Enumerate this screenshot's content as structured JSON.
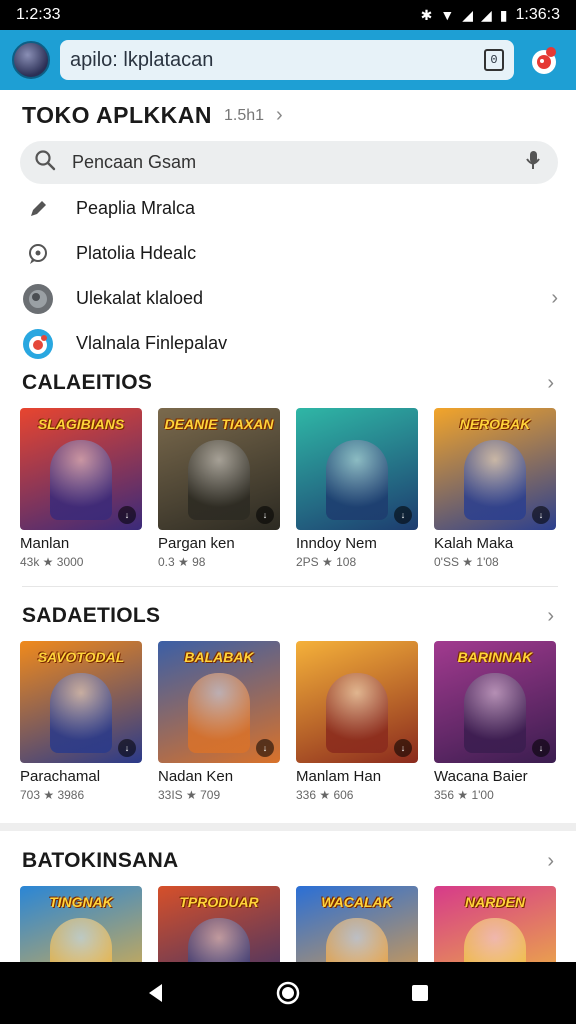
{
  "status_bar": {
    "time_left": "1:2:33",
    "time_right": "1:36:3"
  },
  "app_bar": {
    "search_text": "apilo: lkplatacan",
    "tab_count": "0"
  },
  "store": {
    "title": "TOKO APLKKAN",
    "subtitle": "1.5h1"
  },
  "search": {
    "placeholder": "Pencaan Gsam"
  },
  "menu": [
    {
      "label": "Peaplia Mralca",
      "icon": "pen-icon"
    },
    {
      "label": "Platolia Hdealc",
      "icon": "chat-icon"
    },
    {
      "label": "Ulekalat klaloed",
      "icon": "globe-icon"
    },
    {
      "label": "Vlalnala Finlepalav",
      "icon": "app-logo-icon"
    }
  ],
  "sections": [
    {
      "title": "CALAEITIOS",
      "cards": [
        {
          "name": "Manlan",
          "meta": "43k ★ 3000",
          "banner": "SLAGIBIANS",
          "colors": [
            "#e8452f",
            "#3a2a7a"
          ]
        },
        {
          "name": "Pargan ken",
          "meta": "0.3 ★ 98",
          "banner": "DEANIE  TIAXAN",
          "colors": [
            "#7b6a4d",
            "#2c2a22"
          ]
        },
        {
          "name": "Inndoy Nem",
          "meta": "2PS ★ 108",
          "banner": "",
          "colors": [
            "#2fb7a6",
            "#1d3c6f"
          ]
        },
        {
          "name": "Kalah Maka",
          "meta": "0'SS ★ 1'08",
          "banner": "NEROBAK",
          "colors": [
            "#f3a52a",
            "#2b3f8f"
          ]
        }
      ]
    },
    {
      "title": "SADAETIOLS",
      "cards": [
        {
          "name": "Parachamal",
          "meta": "703 ★ 3986",
          "banner": "SAVOTODAL",
          "colors": [
            "#f08a1c",
            "#2a3a8a"
          ]
        },
        {
          "name": "Nadan Ken",
          "meta": "33IS ★ 709",
          "banner": "BALABAK",
          "colors": [
            "#3b5fa6",
            "#d9722a"
          ]
        },
        {
          "name": "Manlam Han",
          "meta": "336 ★ 606",
          "banner": "",
          "colors": [
            "#f5b13a",
            "#8a2a1d"
          ]
        },
        {
          "name": "Wacana Baier",
          "meta": "356 ★ 1'00",
          "banner": "BARINNAK",
          "colors": [
            "#a23a8f",
            "#3a1d4f"
          ]
        }
      ]
    },
    {
      "title": "BATOKINSANA",
      "cards": [
        {
          "name": "",
          "meta": "",
          "banner": "TINGNAK",
          "colors": [
            "#2a86d6",
            "#f0b33a"
          ]
        },
        {
          "name": "",
          "meta": "",
          "banner": "TPRODUAR",
          "colors": [
            "#d6502a",
            "#2a2f6f"
          ]
        },
        {
          "name": "",
          "meta": "",
          "banner": "WACALAK",
          "colors": [
            "#2a6fd6",
            "#f0a33a"
          ]
        },
        {
          "name": "",
          "meta": "",
          "banner": "NARDEN",
          "colors": [
            "#d63a8a",
            "#f0c33a"
          ]
        }
      ]
    }
  ]
}
